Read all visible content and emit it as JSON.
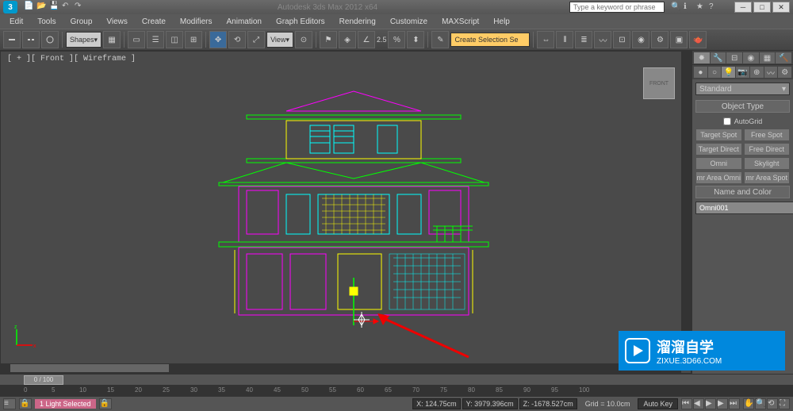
{
  "title": "Autodesk 3ds Max 2012 x64",
  "search_placeholder": "Type a keyword or phrase",
  "menus": [
    "Edit",
    "Tools",
    "Group",
    "Views",
    "Create",
    "Modifiers",
    "Animation",
    "Graph Editors",
    "Rendering",
    "Customize",
    "MAXScript",
    "Help"
  ],
  "toolbar": {
    "shapes_dropdown": "Shapes",
    "view_dropdown": "View",
    "angle_val": "2.5",
    "selection_input": "Create Selection Se"
  },
  "viewport": {
    "label": "[ + ][ Front ][ Wireframe ]",
    "viewcube": "FRONT"
  },
  "right_panel": {
    "category": "Standard",
    "rollout1": "Object Type",
    "autogrid": "AutoGrid",
    "buttons": [
      "Target Spot",
      "Free Spot",
      "Target Direct",
      "Free Direct",
      "Omni",
      "Skylight",
      "mr Area Omni",
      "mr Area Spot"
    ],
    "rollout2": "Name and Color",
    "object_name": "Omni001"
  },
  "timeline": {
    "slider": "0 / 100",
    "ticks": [
      "0",
      "5",
      "10",
      "15",
      "20",
      "25",
      "30",
      "35",
      "40",
      "45",
      "50",
      "55",
      "60",
      "65",
      "70",
      "75",
      "80",
      "85",
      "90",
      "95",
      "100"
    ],
    "status": "1 Light Selected",
    "x": "X: 124.75cm",
    "y": "Y: 3979.396cm",
    "z": "Z: -1678.527cm",
    "grid": "Grid = 10.0cm",
    "autokey": "Auto Key"
  },
  "watermark": {
    "main": "溜溜自学",
    "sub": "ZIXUE.3D66.COM"
  }
}
